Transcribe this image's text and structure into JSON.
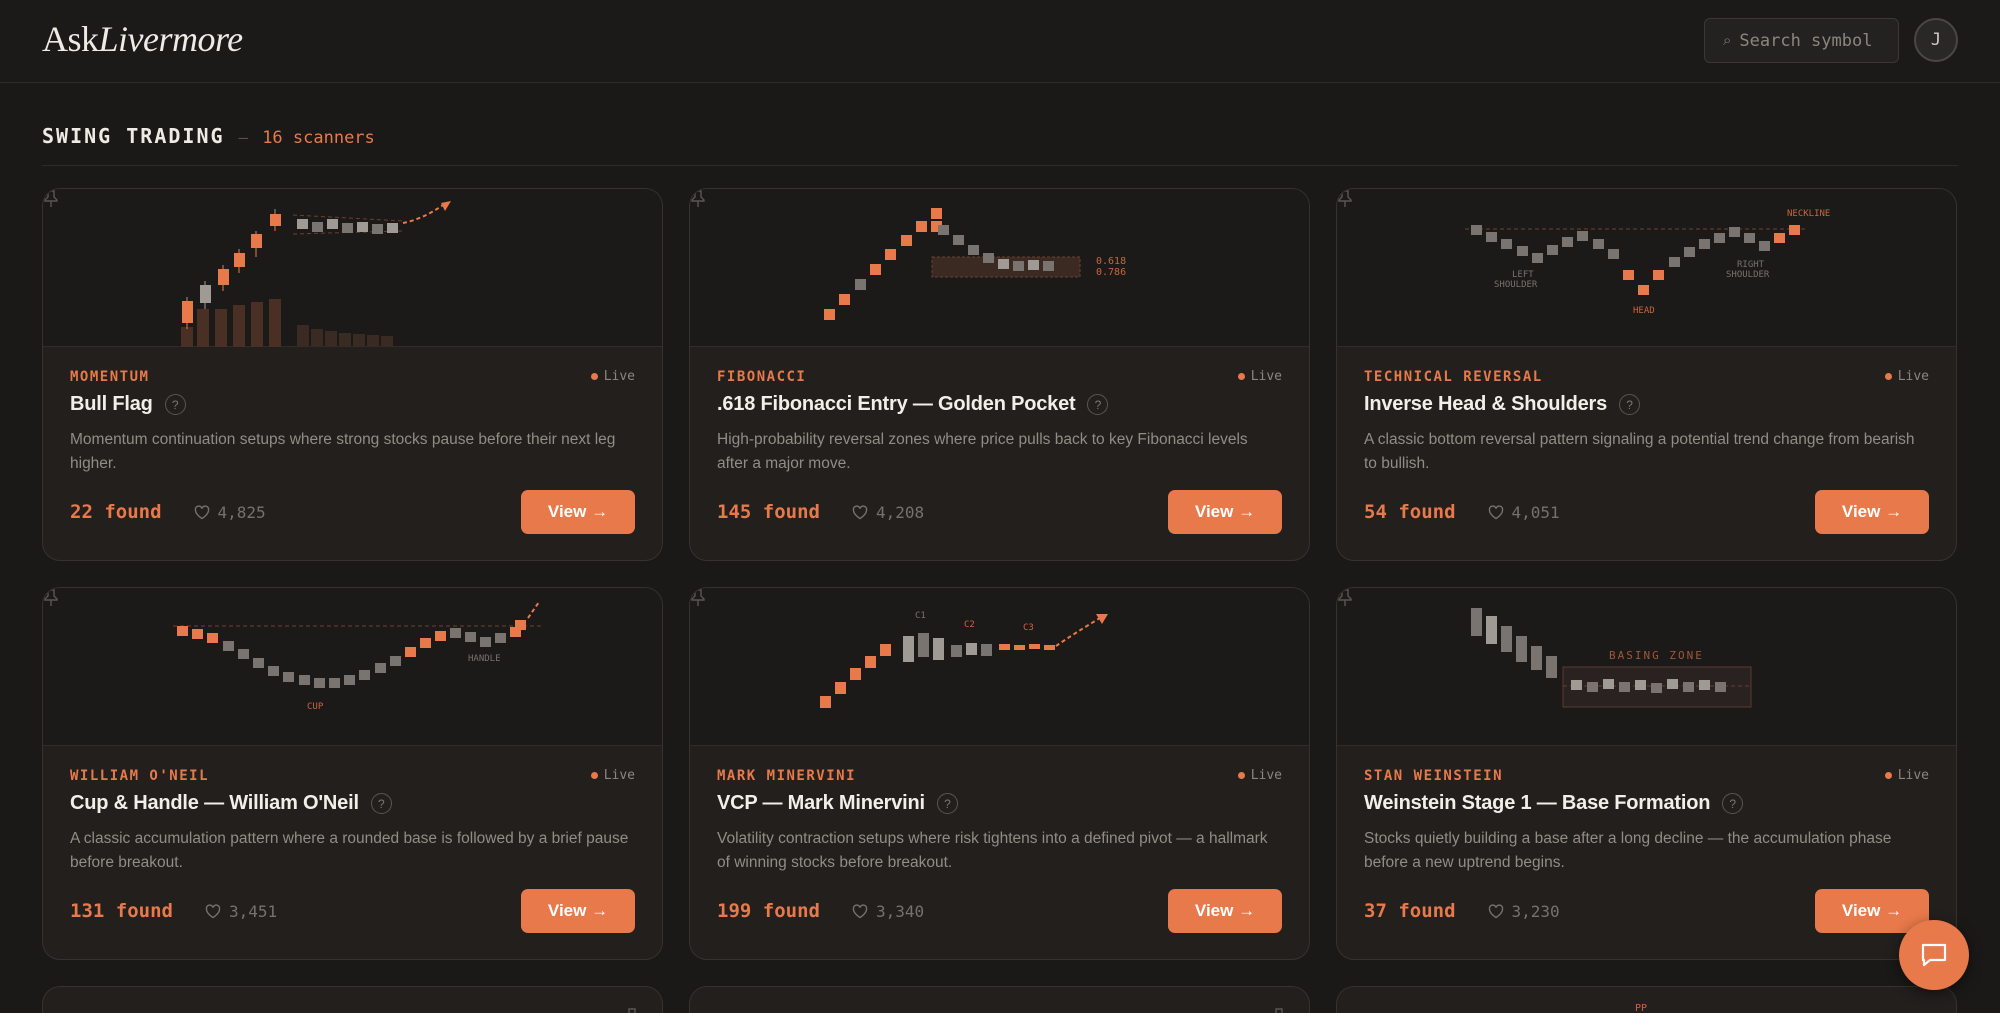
{
  "header": {
    "logo_main": "Ask",
    "logo_italic": "Livermore",
    "search_placeholder": "Search symbol",
    "search_icon": "search-icon",
    "avatar_initial": "J"
  },
  "section": {
    "title": "SWING TRADING",
    "dash": "—",
    "count": "16 scanners"
  },
  "colors": {
    "accent": "#e8794a",
    "background": "#1a1918",
    "card": "#221f1d",
    "muted_candle": "#7a7470"
  },
  "cards": [
    {
      "category": "MOMENTUM",
      "status": "Live",
      "title": "Bull Flag",
      "description": "Momentum continuation setups where strong stocks pause before their next leg higher.",
      "found": "22 found",
      "likes": "4,825",
      "button": "View →",
      "chart_labels": []
    },
    {
      "category": "FIBONACCI",
      "status": "Live",
      "title": ".618 Fibonacci Entry — Golden Pocket",
      "description": "High-probability reversal zones where price pulls back to key Fibonacci levels after a major move.",
      "found": "145 found",
      "likes": "4,208",
      "button": "View →",
      "chart_labels": [
        "0.618",
        "0.786"
      ]
    },
    {
      "category": "TECHNICAL REVERSAL",
      "status": "Live",
      "title": "Inverse Head & Shoulders",
      "description": "A classic bottom reversal pattern signaling a potential trend change from bearish to bullish.",
      "found": "54 found",
      "likes": "4,051",
      "button": "View →",
      "chart_labels": [
        "NECKLINE",
        "LEFT",
        "SHOULDER",
        "HEAD",
        "RIGHT",
        "SHOULDER"
      ]
    },
    {
      "category": "WILLIAM O'NEIL",
      "status": "Live",
      "title": "Cup & Handle — William O'Neil",
      "description": "A classic accumulation pattern where a rounded base is followed by a brief pause before breakout.",
      "found": "131 found",
      "likes": "3,451",
      "button": "View →",
      "chart_labels": [
        "HANDLE",
        "CUP"
      ]
    },
    {
      "category": "MARK MINERVINI",
      "status": "Live",
      "title": "VCP — Mark Minervini",
      "description": "Volatility contraction setups where risk tightens into a defined pivot — a hallmark of winning stocks before breakout.",
      "found": "199 found",
      "likes": "3,340",
      "button": "View →",
      "chart_labels": [
        "C1",
        "C2",
        "C3"
      ]
    },
    {
      "category": "STAN WEINSTEIN",
      "status": "Live",
      "title": "Weinstein Stage 1 — Base Formation",
      "description": "Stocks quietly building a base after a long decline — the accumulation phase before a new uptrend begins.",
      "found": "37 found",
      "likes": "3,230",
      "button": "View →",
      "chart_labels": [
        "BASING ZONE"
      ]
    }
  ],
  "peek": {
    "label": "PP"
  },
  "chat": {
    "icon": "chat-bubble-icon"
  }
}
